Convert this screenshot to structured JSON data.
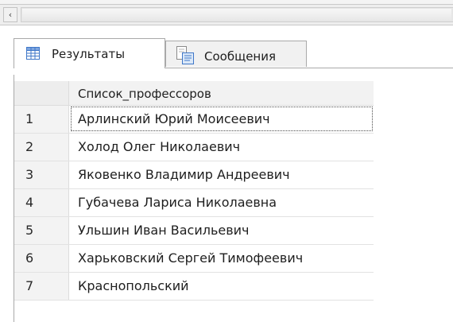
{
  "scrollbar": {
    "left_arrow": "‹"
  },
  "tabs": {
    "results_label": "Результаты",
    "messages_label": "Сообщения"
  },
  "grid": {
    "column_header": "Список_профессоров",
    "rows": [
      {
        "num": "1",
        "value": "Арлинский Юрий Моисеевич"
      },
      {
        "num": "2",
        "value": "Холод Олег Николаевич"
      },
      {
        "num": "3",
        "value": "Яковенко Владимир Андреевич"
      },
      {
        "num": "4",
        "value": "Губачева Лариса Николаевна"
      },
      {
        "num": "5",
        "value": "Ульшин Иван Васильевич"
      },
      {
        "num": "6",
        "value": "Харьковский Сергей Тимофеевич"
      },
      {
        "num": "7",
        "value": "Краснопольский"
      }
    ]
  },
  "icons": {
    "results": "grid-table-icon",
    "messages": "message-document-icon"
  },
  "colors": {
    "tab_border": "#a9a9a9",
    "grid_header_bg": "#f2f2f2",
    "icon_blue": "#3f77c8"
  }
}
